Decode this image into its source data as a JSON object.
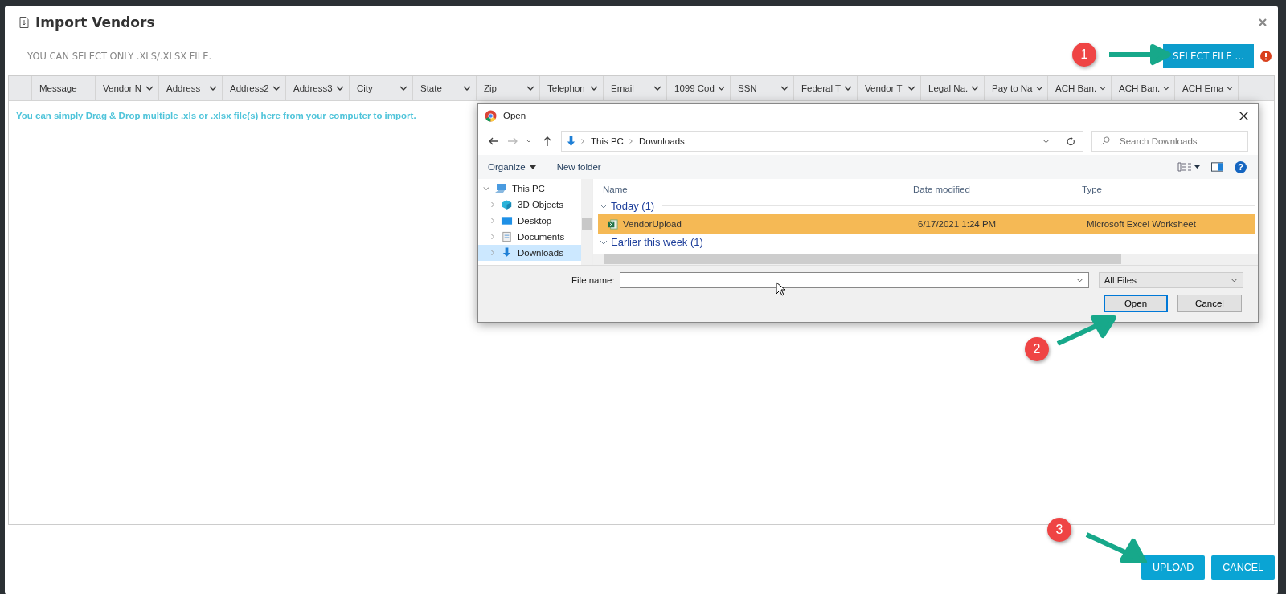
{
  "modal": {
    "title": "Import Vendors",
    "file_field": {
      "placeholder": "YOU CAN SELECT ONLY .XLS/.XLSX FILE."
    },
    "select_button": "SELECT FILE ...",
    "columns": [
      {
        "label": "Message",
        "menu": false
      },
      {
        "label": "Vendor N",
        "menu": true
      },
      {
        "label": "Address",
        "menu": true
      },
      {
        "label": "Address2",
        "menu": true
      },
      {
        "label": "Address3",
        "menu": true
      },
      {
        "label": "City",
        "menu": true
      },
      {
        "label": "State",
        "menu": true
      },
      {
        "label": "Zip",
        "menu": true
      },
      {
        "label": "Telephon",
        "menu": true
      },
      {
        "label": "Email",
        "menu": true
      },
      {
        "label": "1099 Cod",
        "menu": true
      },
      {
        "label": "SSN",
        "menu": true
      },
      {
        "label": "Federal T",
        "menu": true
      },
      {
        "label": "Vendor T",
        "menu": true
      },
      {
        "label": "Legal Na.",
        "menu": true
      },
      {
        "label": "Pay to Na",
        "menu": true
      },
      {
        "label": "ACH Ban.",
        "menu": true
      },
      {
        "label": "ACH Ban.",
        "menu": true
      },
      {
        "label": "ACH Ema",
        "menu": true
      }
    ],
    "drop_hint": "You can simply Drag & Drop multiple .xls or .xlsx file(s) here from your computer to import.",
    "buttons": [
      "UPLOAD",
      "CANCEL"
    ]
  },
  "open_dialog": {
    "title": "Open",
    "nav": [
      {
        "kind": "back",
        "disabled": false
      },
      {
        "kind": "forward",
        "disabled": true
      },
      {
        "kind": "recent",
        "disabled": false
      },
      {
        "kind": "up",
        "disabled": false
      }
    ],
    "breadcrumb": [
      "This PC",
      "Downloads"
    ],
    "search": {
      "placeholder": "Search Downloads"
    },
    "toolbar": [
      "Organize",
      "New folder"
    ],
    "tree": [
      {
        "label": "This PC",
        "kind": "pc",
        "expanded": true,
        "selected": false,
        "children": [
          {
            "label": "3D Objects",
            "kind": "cube",
            "expanded": false,
            "selected": false
          },
          {
            "label": "Desktop",
            "kind": "desktop",
            "expanded": false,
            "selected": false
          },
          {
            "label": "Documents",
            "kind": "documents",
            "expanded": false,
            "selected": false
          },
          {
            "label": "Downloads",
            "kind": "downloads",
            "expanded": false,
            "selected": true
          }
        ]
      }
    ],
    "list_columns": [
      "Name",
      "Date modified",
      "Type"
    ],
    "groups": [
      {
        "label": "Today (1)",
        "files": [
          {
            "name": "VendorUpload",
            "date": "6/17/2021 1:24 PM",
            "type": "Microsoft Excel Worksheet",
            "selected": true
          }
        ]
      },
      {
        "label": "Earlier this week (1)"
      }
    ],
    "help": "?",
    "file_name_label": "File name:",
    "file_type": "All Files",
    "buttons": [
      "Open",
      "Cancel"
    ]
  },
  "callouts": [
    "1",
    "2",
    "3"
  ]
}
